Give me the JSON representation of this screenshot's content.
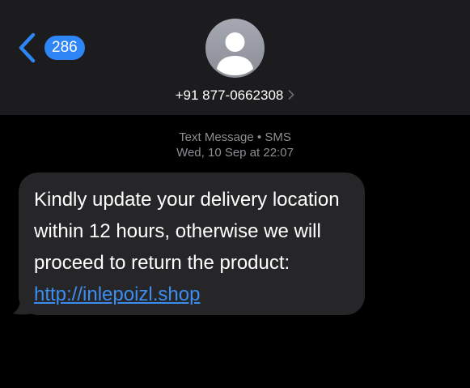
{
  "header": {
    "unread_count": "286",
    "contact_number": "+91 877-0662308"
  },
  "thread": {
    "service_label": "Text Message",
    "separator": "•",
    "service_type": "SMS",
    "timestamp": "Wed, 10 Sep at 22:07"
  },
  "message": {
    "text": "Kindly update your delivery location within 12 hours, otherwise we will proceed to return the product: ",
    "link": "http://inlepoizl.shop"
  },
  "icons": {
    "back": "chevron-left-icon",
    "avatar": "person-silhouette-icon",
    "contact_details": "chevron-right-icon"
  },
  "colors": {
    "accent": "#2e86f5",
    "header_bg": "#1c1c1e",
    "bubble_bg": "#262629",
    "meta_text": "#8e8e93",
    "link": "#3b8ef0"
  }
}
